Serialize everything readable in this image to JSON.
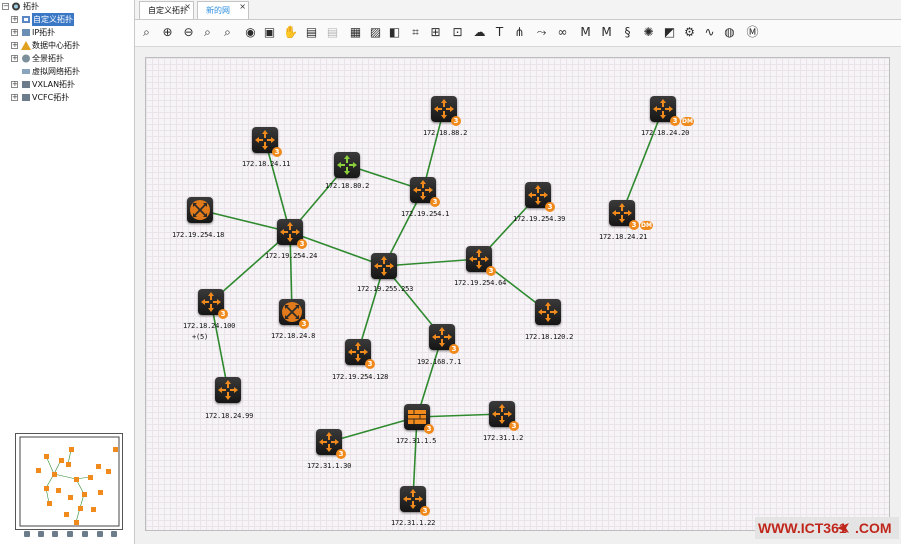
{
  "tree": {
    "root": "拓扑",
    "items": [
      {
        "label": "自定义拓扑",
        "selected": true
      },
      {
        "label": "IP拓扑"
      },
      {
        "label": "数据中心拓扑"
      },
      {
        "label": "全景拓扑"
      },
      {
        "label": "虚拟网络拓扑"
      },
      {
        "label": "VXLAN拓扑"
      },
      {
        "label": "VCFC拓扑"
      }
    ]
  },
  "tabs": [
    {
      "label": "自定义拓扑"
    },
    {
      "label": "新的网络..."
    }
  ],
  "toolbar": {
    "icons": [
      "zoom-fit-icon",
      "zoom-in-icon",
      "zoom-out-icon",
      "zoom-reset-icon",
      "search-icon",
      "eye-icon",
      "fullscreen-icon",
      "hand-pan-icon",
      "image-settings-icon",
      "image-disabled-icon",
      "save-icon",
      "export-image-icon",
      "layer-icon",
      "select-node-icon",
      "hierarchy-icon",
      "add-node-icon",
      "cloud-icon",
      "text-icon",
      "topology-icon",
      "link-icon",
      "binoculars-icon",
      "ms-icon",
      "ms-alt-icon",
      "bolt-icon",
      "gear-burst-icon",
      "group-icon",
      "settings-icon",
      "pulse-icon",
      "globe-icon",
      "m-circle-icon"
    ]
  },
  "nodes": [
    {
      "id": "n1",
      "label": "172.18.88.2",
      "badge": "3",
      "variant": "router"
    },
    {
      "id": "n2",
      "label": "172.18.24.20",
      "badge": "3",
      "badge_extra": "DM",
      "variant": "router"
    },
    {
      "id": "n3",
      "label": "172.18.24.11",
      "badge": "3",
      "variant": "router"
    },
    {
      "id": "n4",
      "label": "172.18.80.2",
      "badge": "",
      "variant": "green"
    },
    {
      "id": "n5",
      "label": "172.19.254.1",
      "badge": "3",
      "variant": "router"
    },
    {
      "id": "n6",
      "label": "172.19.254.39",
      "badge": "3",
      "variant": "router"
    },
    {
      "id": "n7",
      "label": "172.18.24.21",
      "badge": "3",
      "badge_extra": "DM",
      "variant": "router"
    },
    {
      "id": "n8",
      "label": "172.19.254.18",
      "badge": "",
      "variant": "orange-box"
    },
    {
      "id": "n9",
      "label": "172.19.254.24",
      "badge": "3",
      "variant": "router"
    },
    {
      "id": "n10",
      "label": "172.19.255.253",
      "badge": "",
      "variant": "router"
    },
    {
      "id": "n11",
      "label": "172.19.254.64",
      "badge": "3",
      "variant": "router"
    },
    {
      "id": "n12",
      "label": "172.18.24.100",
      "badge": "3",
      "variant": "router",
      "sublabel": "+(5)"
    },
    {
      "id": "n13",
      "label": "172.18.24.8",
      "badge": "3",
      "variant": "orange-box"
    },
    {
      "id": "n14",
      "label": "172.18.120.2",
      "badge": "",
      "variant": "router"
    },
    {
      "id": "n15",
      "label": "192.168.7.1",
      "badge": "3",
      "variant": "router"
    },
    {
      "id": "n16",
      "label": "172.19.254.128",
      "badge": "3",
      "variant": "router"
    },
    {
      "id": "n17",
      "label": "172.18.24.99",
      "badge": "",
      "variant": "router"
    },
    {
      "id": "n18",
      "label": "172.31.1.5",
      "badge": "3",
      "variant": "firewall"
    },
    {
      "id": "n19",
      "label": "172.31.1.2",
      "badge": "3",
      "variant": "router"
    },
    {
      "id": "n20",
      "label": "172.31.1.30",
      "badge": "3",
      "variant": "router"
    },
    {
      "id": "n21",
      "label": "172.31.1.22",
      "badge": "3",
      "variant": "router"
    }
  ],
  "links": [
    [
      "n1",
      "n5"
    ],
    [
      "n2",
      "n7"
    ],
    [
      "n3",
      "n9"
    ],
    [
      "n4",
      "n9"
    ],
    [
      "n4",
      "n5"
    ],
    [
      "n8",
      "n9"
    ],
    [
      "n9",
      "n12"
    ],
    [
      "n9",
      "n13"
    ],
    [
      "n9",
      "n10"
    ],
    [
      "n5",
      "n10"
    ],
    [
      "n10",
      "n11"
    ],
    [
      "n6",
      "n11"
    ],
    [
      "n11",
      "n14"
    ],
    [
      "n10",
      "n15"
    ],
    [
      "n10",
      "n16"
    ],
    [
      "n12",
      "n17"
    ],
    [
      "n15",
      "n18"
    ],
    [
      "n18",
      "n19"
    ],
    [
      "n18",
      "n20"
    ],
    [
      "n18",
      "n21"
    ]
  ],
  "colors": {
    "link": "#2f8a2f",
    "badge": "#f08a1c",
    "tab_active": "#2b8de0",
    "tree_selected": "#3a78c6"
  },
  "watermark": {
    "part1": "WWW.ICT361",
    "part2": ".COM"
  }
}
